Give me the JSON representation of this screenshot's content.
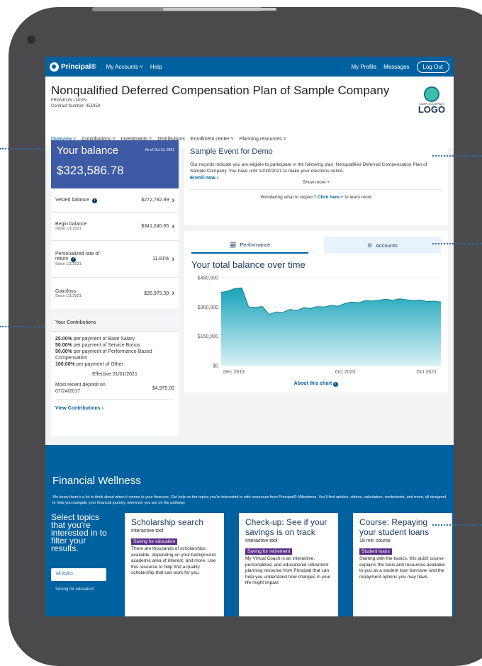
{
  "topbar": {
    "brand": "Principal®",
    "nav": [
      "My Accounts ˅",
      "Help"
    ],
    "my_profile": "My Profile",
    "messages": "Messages",
    "logout": "Log Out"
  },
  "header": {
    "title": "Nonqualified Deferred Compensation Plan of Sample Company",
    "login": "FRANKLIN LOGIN",
    "contract": "Contract Number: 451958",
    "logo_small": "SAMPLECOMPANY",
    "logo_big": "LOGO",
    "tabs": [
      "Overview ˅",
      "Contributions ˅",
      "Investments ˅",
      "Distributions",
      "Enrollment center ˅",
      "Planning resources ˅"
    ]
  },
  "balance": {
    "label": "Your balance",
    "as_of": "As of Oct 13, 2021",
    "amount": "$323,586.78",
    "rows": [
      {
        "label": "Vested balance",
        "since": "",
        "value": "$272,782.89"
      },
      {
        "label": "Begin balance",
        "since": "Since 1/1/2021",
        "value": "$341,240.65"
      },
      {
        "label": "Personalized rate of return",
        "since": "Since 1/1/2021",
        "value": "11.81%"
      },
      {
        "label": "Gain/loss",
        "since": "Since 1/1/2021",
        "value": "$35,975.39"
      }
    ]
  },
  "contributions": {
    "title": "Your Contributions",
    "lines": [
      {
        "pct": "25.00%",
        "text": "per payment of Base Salary"
      },
      {
        "pct": "50.00%",
        "text": "per payment of Service Bonus"
      },
      {
        "pct": "50.00%",
        "text": "per payment of Performance-Based Compensation"
      },
      {
        "pct": "100.00%",
        "text": "per payment of Other"
      }
    ],
    "effective": "Effective 01/01/2021",
    "deposit_label": "Most recent deposit on 07/24/2017",
    "deposit_value": "$4,975.00",
    "view_link": "View Contributions ›"
  },
  "event": {
    "title": "Sample Event for Demo",
    "text": "Our records indicate you are eligible to participate in the following plan: Nonqualified Deferred Compensation Plan of Sample Company. You have until 12/30/2021 to make your elections online.",
    "enroll": "Enroll now ›",
    "show_more": "Show more ˅",
    "wondering": "Wondering what to expect?",
    "click_here": "Click here",
    "learn_more": "to learn more"
  },
  "performance": {
    "tab_performance": "Performance",
    "tab_accounts": "Accounts",
    "title": "Your total balance over time",
    "about": "About this chart"
  },
  "chart_data": {
    "type": "area",
    "title": "Your total balance over time",
    "x_ticks": [
      "Dec 2019",
      "Oct 2020",
      "Oct 2021"
    ],
    "y_ticks": [
      "$0",
      "$150,000",
      "$300,000",
      "$450,000"
    ],
    "ylim": [
      0,
      450000
    ],
    "values": [
      375000,
      382000,
      395000,
      398000,
      300000,
      298000,
      303000,
      262000,
      275000,
      272000,
      288000,
      282000,
      296000,
      292000,
      302000,
      300000,
      308000,
      304000,
      318000,
      326000,
      322000,
      333000,
      331000,
      335000,
      340000,
      335000,
      342000,
      337000,
      333000,
      336000,
      328000,
      330000,
      326000
    ]
  },
  "wellness": {
    "title": "Financial Wellness",
    "intro": "We know there's a lot to think about when it comes to your finances. Get help on the topics you're interested in with resources from Principal® Milestones. You'll find articles, videos, calculators, worksheets, and more, all designed to help you navigate your financial journey, wherever you are on the pathway.",
    "topics_head": "Select topics that you're interested in to filter your results.",
    "all_topics": "All topics",
    "topic2": "Saving for education",
    "cards": [
      {
        "title": "Scholarship search",
        "kind": "Interactive tool",
        "tag": "Saving for education",
        "desc": "There are thousands of scholarships available, depending on your background, academic area of interest, and more. Use this resource to help find a quality scholarship that can work for you."
      },
      {
        "title": "Check-up: See if your savings is on track",
        "kind": "Interactive tool",
        "tag": "Saving for retirement",
        "desc": "My Virtual Coach is an interactive, personalized, and educational retirement planning resource from Principal that can help you understand how changes in your life might impact"
      },
      {
        "title": "Course: Repaying your student loans",
        "kind": "18 min course",
        "tag": "Student loans",
        "desc": "Starting with the basics, this quick course explains the tools and resources available to you as a student loan borrower and the repayment options you may have."
      }
    ]
  }
}
